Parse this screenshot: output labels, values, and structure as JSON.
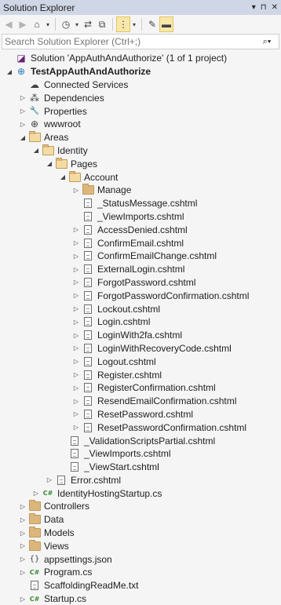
{
  "window": {
    "title": "Solution Explorer",
    "controls": [
      "▾",
      "⊓",
      "✕"
    ]
  },
  "toolbar": {
    "icons": [
      "back-icon",
      "forward-icon",
      "home-icon",
      "dropdown",
      "history-icon",
      "dropdown",
      "sync-icon",
      "collapse-all-icon",
      "show-all-files-icon",
      "dropdown",
      "properties-icon",
      "preview-icon"
    ]
  },
  "search": {
    "placeholder": "Search Solution Explorer (Ctrl+;)",
    "icon": "⌕▾"
  },
  "tree": [
    {
      "label": "Solution 'AppAuthAndAuthorize' (1 of 1 project)",
      "icon": "solution-icon",
      "indent": 0,
      "expander": "",
      "bold": false
    },
    {
      "label": "TestAppAuthAndAuthorize",
      "icon": "web-project-icon",
      "indent": 0,
      "expander": "◢",
      "bold": true
    },
    {
      "label": "Connected Services",
      "icon": "connected-services-icon",
      "indent": 1,
      "expander": "",
      "bold": false
    },
    {
      "label": "Dependencies",
      "icon": "dependencies-icon",
      "indent": 1,
      "expander": "▷",
      "bold": false
    },
    {
      "label": "Properties",
      "icon": "wrench-icon",
      "indent": 1,
      "expander": "▷",
      "bold": false
    },
    {
      "label": "wwwroot",
      "icon": "globe-icon",
      "indent": 1,
      "expander": "▷",
      "bold": false
    },
    {
      "label": "Areas",
      "icon": "folder-open-icon",
      "indent": 1,
      "expander": "◢",
      "bold": false
    },
    {
      "label": "Identity",
      "icon": "folder-open-icon",
      "indent": 2,
      "expander": "◢",
      "bold": false
    },
    {
      "label": "Pages",
      "icon": "folder-open-icon",
      "indent": 3,
      "expander": "◢",
      "bold": false
    },
    {
      "label": "Account",
      "icon": "folder-open-icon",
      "indent": 4,
      "expander": "◢",
      "bold": false
    },
    {
      "label": "Manage",
      "icon": "folder-icon",
      "indent": 5,
      "expander": "▷",
      "bold": false
    },
    {
      "label": "_StatusMessage.cshtml",
      "icon": "cshtml-file-icon",
      "indent": 5,
      "expander": "",
      "bold": false
    },
    {
      "label": "_ViewImports.cshtml",
      "icon": "cshtml-file-icon",
      "indent": 5,
      "expander": "",
      "bold": false
    },
    {
      "label": "AccessDenied.cshtml",
      "icon": "cshtml-file-icon",
      "indent": 5,
      "expander": "▷",
      "bold": false
    },
    {
      "label": "ConfirmEmail.cshtml",
      "icon": "cshtml-file-icon",
      "indent": 5,
      "expander": "▷",
      "bold": false
    },
    {
      "label": "ConfirmEmailChange.cshtml",
      "icon": "cshtml-file-icon",
      "indent": 5,
      "expander": "▷",
      "bold": false
    },
    {
      "label": "ExternalLogin.cshtml",
      "icon": "cshtml-file-icon",
      "indent": 5,
      "expander": "▷",
      "bold": false
    },
    {
      "label": "ForgotPassword.cshtml",
      "icon": "cshtml-file-icon",
      "indent": 5,
      "expander": "▷",
      "bold": false
    },
    {
      "label": "ForgotPasswordConfirmation.cshtml",
      "icon": "cshtml-file-icon",
      "indent": 5,
      "expander": "▷",
      "bold": false
    },
    {
      "label": "Lockout.cshtml",
      "icon": "cshtml-file-icon",
      "indent": 5,
      "expander": "▷",
      "bold": false
    },
    {
      "label": "Login.cshtml",
      "icon": "cshtml-file-icon",
      "indent": 5,
      "expander": "▷",
      "bold": false
    },
    {
      "label": "LoginWith2fa.cshtml",
      "icon": "cshtml-file-icon",
      "indent": 5,
      "expander": "▷",
      "bold": false
    },
    {
      "label": "LoginWithRecoveryCode.cshtml",
      "icon": "cshtml-file-icon",
      "indent": 5,
      "expander": "▷",
      "bold": false
    },
    {
      "label": "Logout.cshtml",
      "icon": "cshtml-file-icon",
      "indent": 5,
      "expander": "▷",
      "bold": false
    },
    {
      "label": "Register.cshtml",
      "icon": "cshtml-file-icon",
      "indent": 5,
      "expander": "▷",
      "bold": false
    },
    {
      "label": "RegisterConfirmation.cshtml",
      "icon": "cshtml-file-icon",
      "indent": 5,
      "expander": "▷",
      "bold": false
    },
    {
      "label": "ResendEmailConfirmation.cshtml",
      "icon": "cshtml-file-icon",
      "indent": 5,
      "expander": "▷",
      "bold": false
    },
    {
      "label": "ResetPassword.cshtml",
      "icon": "cshtml-file-icon",
      "indent": 5,
      "expander": "▷",
      "bold": false
    },
    {
      "label": "ResetPasswordConfirmation.cshtml",
      "icon": "cshtml-file-icon",
      "indent": 5,
      "expander": "▷",
      "bold": false
    },
    {
      "label": "_ValidationScriptsPartial.cshtml",
      "icon": "cshtml-file-icon",
      "indent": 4,
      "expander": "",
      "bold": false
    },
    {
      "label": "_ViewImports.cshtml",
      "icon": "cshtml-file-icon",
      "indent": 4,
      "expander": "",
      "bold": false
    },
    {
      "label": "_ViewStart.cshtml",
      "icon": "cshtml-file-icon",
      "indent": 4,
      "expander": "",
      "bold": false
    },
    {
      "label": "Error.cshtml",
      "icon": "cshtml-file-icon",
      "indent": 3,
      "expander": "▷",
      "bold": false
    },
    {
      "label": "IdentityHostingStartup.cs",
      "icon": "csharp-file-icon",
      "indent": 2,
      "expander": "▷",
      "bold": false
    },
    {
      "label": "Controllers",
      "icon": "folder-icon",
      "indent": 1,
      "expander": "▷",
      "bold": false
    },
    {
      "label": "Data",
      "icon": "folder-icon",
      "indent": 1,
      "expander": "▷",
      "bold": false
    },
    {
      "label": "Models",
      "icon": "folder-icon",
      "indent": 1,
      "expander": "▷",
      "bold": false
    },
    {
      "label": "Views",
      "icon": "folder-icon",
      "indent": 1,
      "expander": "▷",
      "bold": false
    },
    {
      "label": "appsettings.json",
      "icon": "json-file-icon",
      "indent": 1,
      "expander": "▷",
      "bold": false
    },
    {
      "label": "Program.cs",
      "icon": "csharp-file-icon",
      "indent": 1,
      "expander": "▷",
      "bold": false
    },
    {
      "label": "ScaffoldingReadMe.txt",
      "icon": "text-file-icon",
      "indent": 1,
      "expander": "",
      "bold": false
    },
    {
      "label": "Startup.cs",
      "icon": "csharp-file-icon",
      "indent": 1,
      "expander": "▷",
      "bold": false
    }
  ]
}
